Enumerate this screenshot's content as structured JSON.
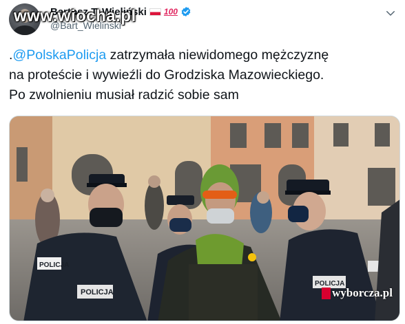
{
  "author": {
    "display_name": "Bartosz T. Wieliński",
    "handle": "@Bart_Wielinski",
    "badge_text": "100",
    "icons": [
      "poland-flag-icon",
      "hundred-points-icon",
      "verified-badge-icon"
    ]
  },
  "watermark_top": "www.wiocha.pl",
  "tweet": {
    "line1_prefix": ".",
    "line1_mention": "@PolskaPolicja",
    "line1_rest": " zatrzymała niewidomego mężczyznę",
    "line2": "na proteście i wywieźli do Grodziska Mazowieckiego.",
    "line3": "Po zwolnieniu musiał radzić sobie sam"
  },
  "media": {
    "police_label_left": "POLICJA",
    "police_label_center": "POLICJA",
    "police_label_right": "POLICJA",
    "watermark_media": "wyborcza.pl"
  },
  "colors": {
    "link": "#1d9bf0",
    "verified": "#1d9bf0",
    "wyborcza_red": "#d8002f"
  }
}
